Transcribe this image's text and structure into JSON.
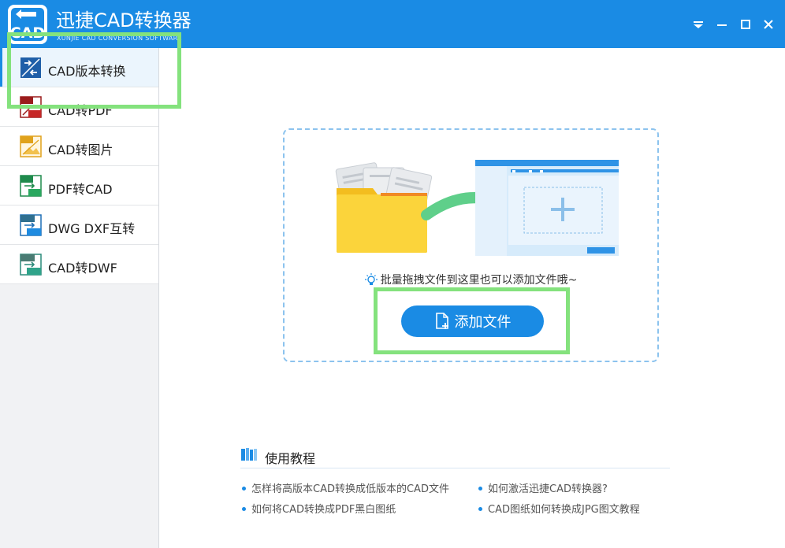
{
  "app": {
    "logo_text": "CAD",
    "title": "迅捷CAD转换器",
    "subtitle": "XUNJIE CAD CONVERSION SOFTWARE"
  },
  "window_controls": [
    "menu-icon",
    "minimize-icon",
    "maximize-icon",
    "close-icon"
  ],
  "sidebar": {
    "items": [
      {
        "label": "CAD版本转换",
        "icon": "cad-version-icon",
        "active": true
      },
      {
        "label": "CAD转PDF",
        "icon": "cad-to-pdf-icon",
        "active": false
      },
      {
        "label": "CAD转图片",
        "icon": "cad-to-image-icon",
        "active": false
      },
      {
        "label": "PDF转CAD",
        "icon": "pdf-to-cad-icon",
        "active": false
      },
      {
        "label": "DWG DXF互转",
        "icon": "dwg-dxf-icon",
        "active": false
      },
      {
        "label": "CAD转DWF",
        "icon": "cad-to-dwf-icon",
        "active": false
      }
    ]
  },
  "dropzone": {
    "hint": "批量拖拽文件到这里也可以添加文件哦~",
    "add_button": "添加文件"
  },
  "tutorials": {
    "title": "使用教程",
    "links": [
      "怎样将高版本CAD转换成低版本的CAD文件",
      "如何激活迅捷CAD转换器?",
      "如何将CAD转换成PDF黑白图纸",
      "CAD图纸如何转换成JPG图文教程"
    ]
  },
  "colors": {
    "brand": "#1a8be4",
    "highlight": "#84e27d",
    "arrow": "#5fcf8a",
    "folder": "#f6c92b"
  }
}
